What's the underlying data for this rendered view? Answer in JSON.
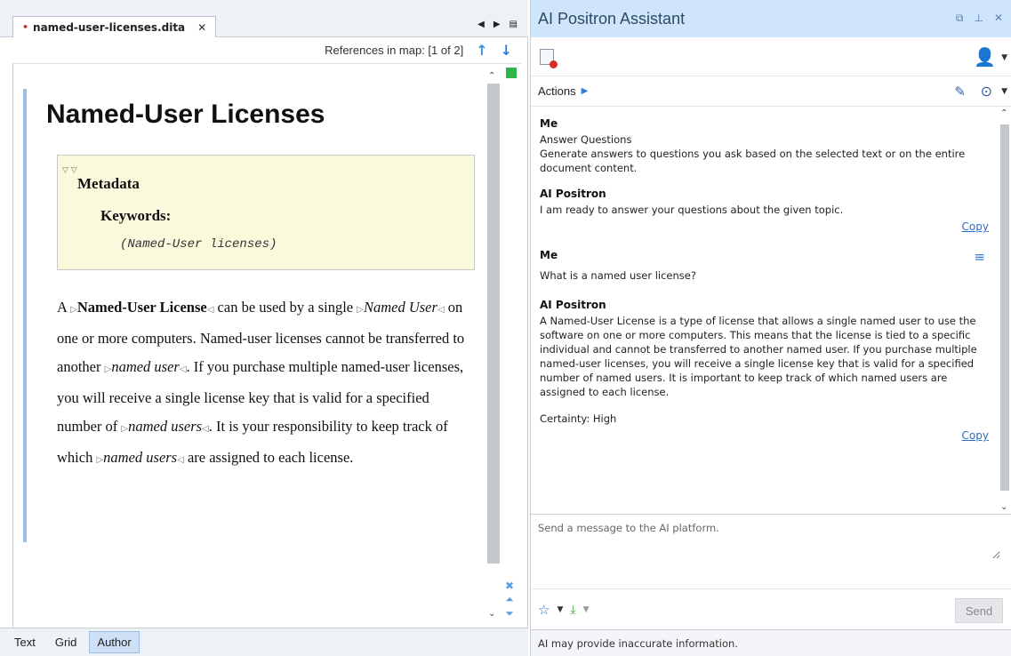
{
  "editor": {
    "tab_title": "named-user-licenses.dita",
    "modified_marker": "•",
    "references_text": "References in map: [1 of 2]",
    "doc_title": "Named-User Licenses",
    "metadata_heading": "Metadata",
    "keywords_label": "Keywords:",
    "keywords_value": "(Named-User licenses)",
    "para": {
      "p1": "A ",
      "t1": "Named-User License",
      "p2": " can be used by a single ",
      "t2": "Named User",
      "p3": " on one or more computers. Named-user licenses cannot be transferred to another ",
      "t3": "named user",
      "p4": ". If you purchase multiple named-user licenses, you will receive a single license key that is valid for a specified number of ",
      "t4": "named users",
      "p5": ". It is your responsibility to keep track of which ",
      "t5": "named users",
      "p6": " are assigned to each license."
    },
    "modes": [
      "Text",
      "Grid",
      "Author"
    ],
    "active_mode": "Author"
  },
  "assistant": {
    "title": "AI Positron Assistant",
    "actions_label": "Actions",
    "messages": [
      {
        "sender": "Me",
        "lines": [
          "Answer Questions",
          "Generate answers to questions you ask based on the selected text or on the entire document content."
        ]
      },
      {
        "sender": "AI Positron",
        "text": "I am ready to answer your questions about the given topic.",
        "copy": "Copy"
      },
      {
        "sender": "Me",
        "text": "What is a named user license?"
      },
      {
        "sender": "AI Positron",
        "text": "A Named-User License is a type of license that allows a single named user to use the software on one or more computers. This means that the license is tied to a specific individual and cannot be transferred to another named user. If you purchase multiple named-user licenses, you will receive a single license key that is valid for a specified number of named users. It is important to keep track of which named users are assigned to each license.",
        "certainty": "Certainty: High",
        "copy": "Copy"
      }
    ],
    "input_placeholder": "Send a message to the AI platform.",
    "send_label": "Send",
    "disclaimer": "AI may provide inaccurate information."
  },
  "icons": {
    "tab_close": "close-icon",
    "prev_ref": "arrow-up-icon",
    "next_ref": "arrow-down-icon",
    "user": "user-icon",
    "edit": "edit-icon",
    "history": "history-icon",
    "favorites": "star-icon"
  },
  "colors": {
    "assistant_header": "#cfe5fb",
    "accent_blue": "#2d7fd8",
    "metadata_bg": "#fbf9dc",
    "status_ok": "#31b44a",
    "modified_red": "#d0312d"
  }
}
